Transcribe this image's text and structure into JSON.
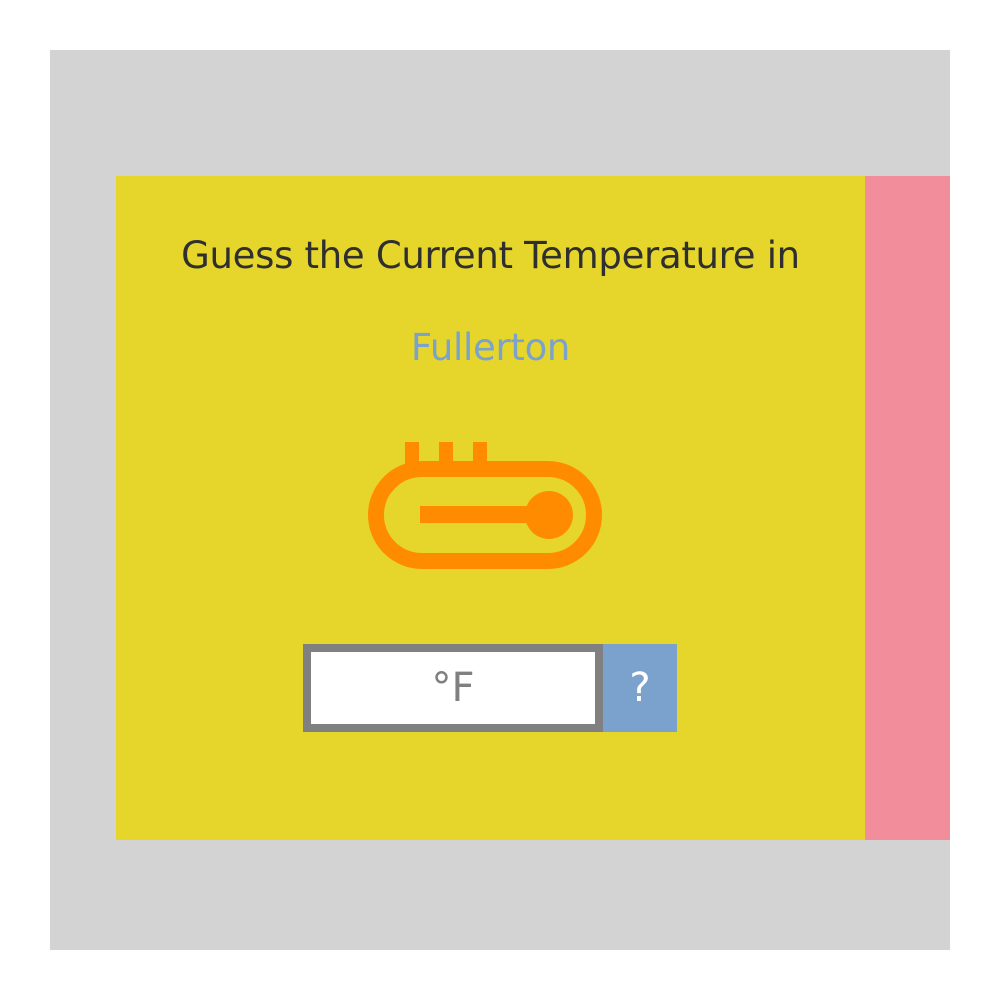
{
  "game": {
    "prompt": "Guess the Current Temperature in",
    "city": "Fullerton",
    "icon": "thermometer-icon",
    "input": {
      "value": "",
      "placeholder": "°F"
    },
    "submit_label": "?"
  },
  "colors": {
    "background": "#d3d3d3",
    "card": "#e6d52b",
    "next_card": "#f28e9c",
    "prompt_text": "#2f2f2f",
    "city_text": "#7ba2cc",
    "icon": "#ff8c00",
    "input_border": "#808080",
    "button": "#7ba2cc"
  }
}
